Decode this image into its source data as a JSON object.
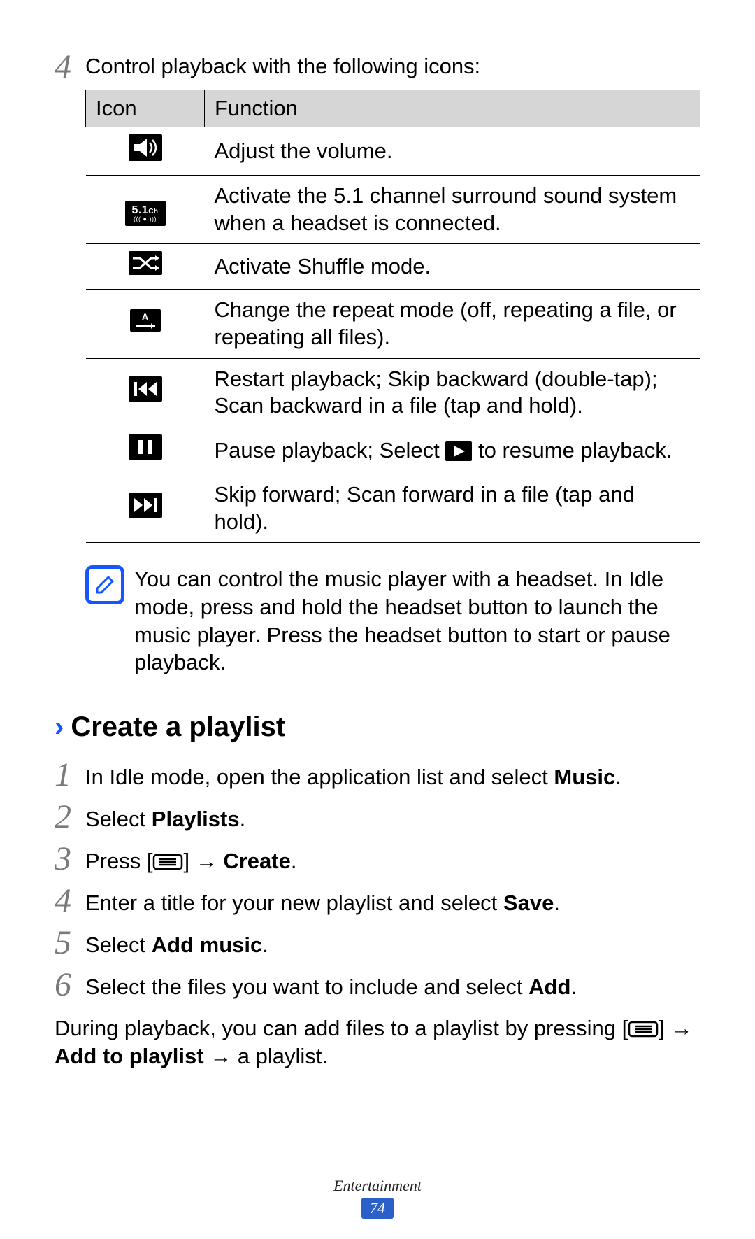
{
  "intro": {
    "num": "4",
    "text": "Control playback with the following icons:"
  },
  "table": {
    "headers": {
      "icon": "Icon",
      "func": "Function"
    },
    "rows": [
      {
        "icon_name": "volume-icon",
        "func": "Adjust the volume."
      },
      {
        "icon_name": "surround-51-icon",
        "func": "Activate the 5.1 channel surround sound system when a headset is connected."
      },
      {
        "icon_name": "shuffle-icon",
        "func": "Activate Shuffle mode."
      },
      {
        "icon_name": "repeat-icon",
        "func": "Change the repeat mode (off, repeating a file, or repeating all files)."
      },
      {
        "icon_name": "skip-back-icon",
        "func": "Restart playback; Skip backward (double-tap); Scan backward in a file (tap and hold)."
      },
      {
        "icon_name": "pause-icon",
        "func_pre": "Pause playback; Select ",
        "func_post": " to resume playback."
      },
      {
        "icon_name": "skip-forward-icon",
        "func": "Skip forward; Scan forward in a file (tap and hold)."
      }
    ]
  },
  "note": {
    "text": "You can control the music player with a headset. In Idle mode, press and hold the headset button to launch the music player. Press the headset button to start or pause playback."
  },
  "section": {
    "title": "Create a playlist",
    "steps": {
      "s1": {
        "num": "1",
        "pre": "In Idle mode, open the application list and select ",
        "bold": "Music",
        "post": "."
      },
      "s2": {
        "num": "2",
        "pre": "Select ",
        "bold": "Playlists",
        "post": "."
      },
      "s3": {
        "num": "3",
        "pre": "Press [",
        "mid": "] → ",
        "bold": "Create",
        "post": "."
      },
      "s4": {
        "num": "4",
        "pre": "Enter a title for your new playlist and select ",
        "bold": "Save",
        "post": "."
      },
      "s5": {
        "num": "5",
        "pre": "Select ",
        "bold": "Add music",
        "post": "."
      },
      "s6": {
        "num": "6",
        "pre": "Select the files you want to include and select ",
        "bold": "Add",
        "post": "."
      }
    },
    "after": {
      "pre": "During playback, you can add files to a playlist by pressing [",
      "mid": "] → ",
      "bold": "Add to playlist",
      "post": " → a playlist."
    }
  },
  "footer": {
    "category": "Entertainment",
    "page": "74"
  },
  "icon_labels": {
    "five_one": "5.1",
    "ch": "Ch",
    "a": "A"
  }
}
